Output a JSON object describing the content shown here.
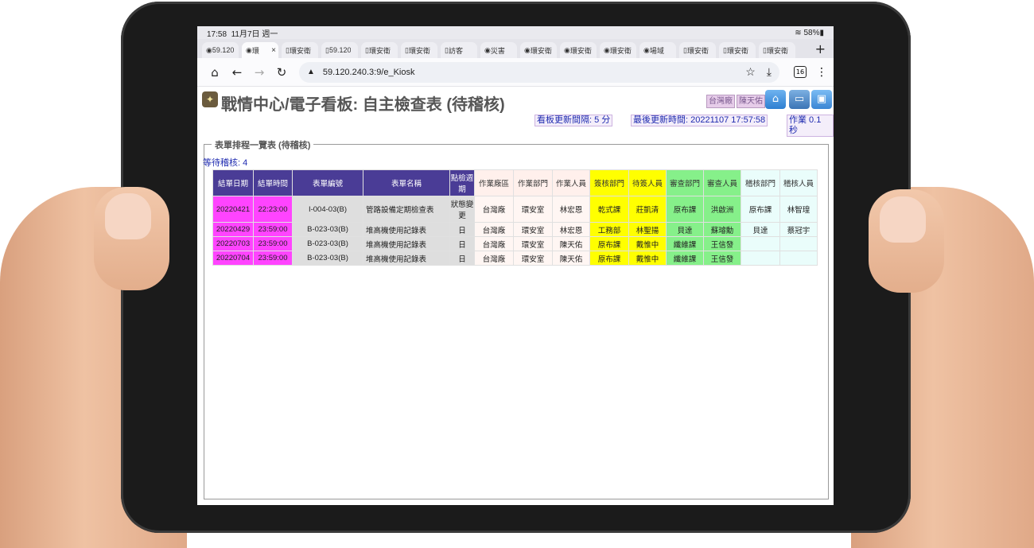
{
  "status": {
    "time": "17:58",
    "date": "11月7日 週一",
    "battery": "58%"
  },
  "tabs": [
    {
      "label": "59.120",
      "icon": "globe-icon",
      "active": false
    },
    {
      "label": "環",
      "icon": "globe-icon",
      "active": true
    },
    {
      "label": "環安衛",
      "icon": "doc-icon",
      "active": false
    },
    {
      "label": "59.120",
      "icon": "doc-icon",
      "active": false
    },
    {
      "label": "環安衛",
      "icon": "doc-icon",
      "active": false
    },
    {
      "label": "環安衛",
      "icon": "doc-icon",
      "active": false
    },
    {
      "label": "訪客",
      "icon": "doc-icon",
      "active": false
    },
    {
      "label": "災害",
      "icon": "globe-icon",
      "active": false
    },
    {
      "label": "環安衛",
      "icon": "globe-icon",
      "active": false
    },
    {
      "label": "環安衛",
      "icon": "globe-icon",
      "active": false
    },
    {
      "label": "環安衛",
      "icon": "globe-icon",
      "active": false
    },
    {
      "label": "場域",
      "icon": "globe-icon",
      "active": false
    },
    {
      "label": "環安衛",
      "icon": "doc-icon",
      "active": false
    },
    {
      "label": "環安衛",
      "icon": "doc-icon",
      "active": false
    },
    {
      "label": "環安衛",
      "icon": "doc-icon",
      "active": false
    }
  ],
  "toolbar": {
    "url": "59.120.240.3:9/e_Kiosk",
    "tab_count": "16"
  },
  "header": {
    "title": "戰情中心/電子看板: 自主檢查表 (待稽核)",
    "plant_badge": "台灣廠",
    "user_badge": "陳天佑"
  },
  "info": {
    "refresh_interval": "看板更新間隔: 5 分",
    "last_updated": "最後更新時間: 20221107 17:57:58",
    "operation_time": "作業 0.1 秒"
  },
  "section": {
    "legend": "表單排程一覽表 (待稽核)",
    "pending": "等待稽核: 4"
  },
  "table": {
    "headers": [
      "結單日期",
      "結單時間",
      "表單編號",
      "表單名稱",
      "點檢週期",
      "作業廠區",
      "作業部門",
      "作業人員",
      "簽核部門",
      "待簽人員",
      "審查部門",
      "審查人員",
      "稽核部門",
      "稽核人員"
    ],
    "rows": [
      [
        "20220421",
        "22:23:00",
        "I-004-03(B)",
        "管路設備定期檢查表",
        "狀態變更",
        "台灣廠",
        "環安室",
        "林宏恩",
        "乾式課",
        "莊凱清",
        "原布課",
        "洪啟洲",
        "原布課",
        "林智瑝"
      ],
      [
        "20220429",
        "23:59:00",
        "B-023-03(B)",
        "堆高機使用記錄表",
        "日",
        "台灣廠",
        "環安室",
        "林宏恩",
        "工務部",
        "林聖揚",
        "貝達",
        "蘇璿勳",
        "貝達",
        "蔡冠宇"
      ],
      [
        "20220703",
        "23:59:00",
        "B-023-03(B)",
        "堆高機使用記錄表",
        "日",
        "台灣廠",
        "環安室",
        "陳天佑",
        "原布課",
        "戴惟中",
        "纖維課",
        "王信發",
        "",
        ""
      ],
      [
        "20220704",
        "23:59:00",
        "B-023-03(B)",
        "堆高機使用記錄表",
        "日",
        "台灣廠",
        "環安室",
        "陳天佑",
        "原布課",
        "戴惟中",
        "纖維課",
        "王信發",
        "",
        ""
      ]
    ]
  }
}
